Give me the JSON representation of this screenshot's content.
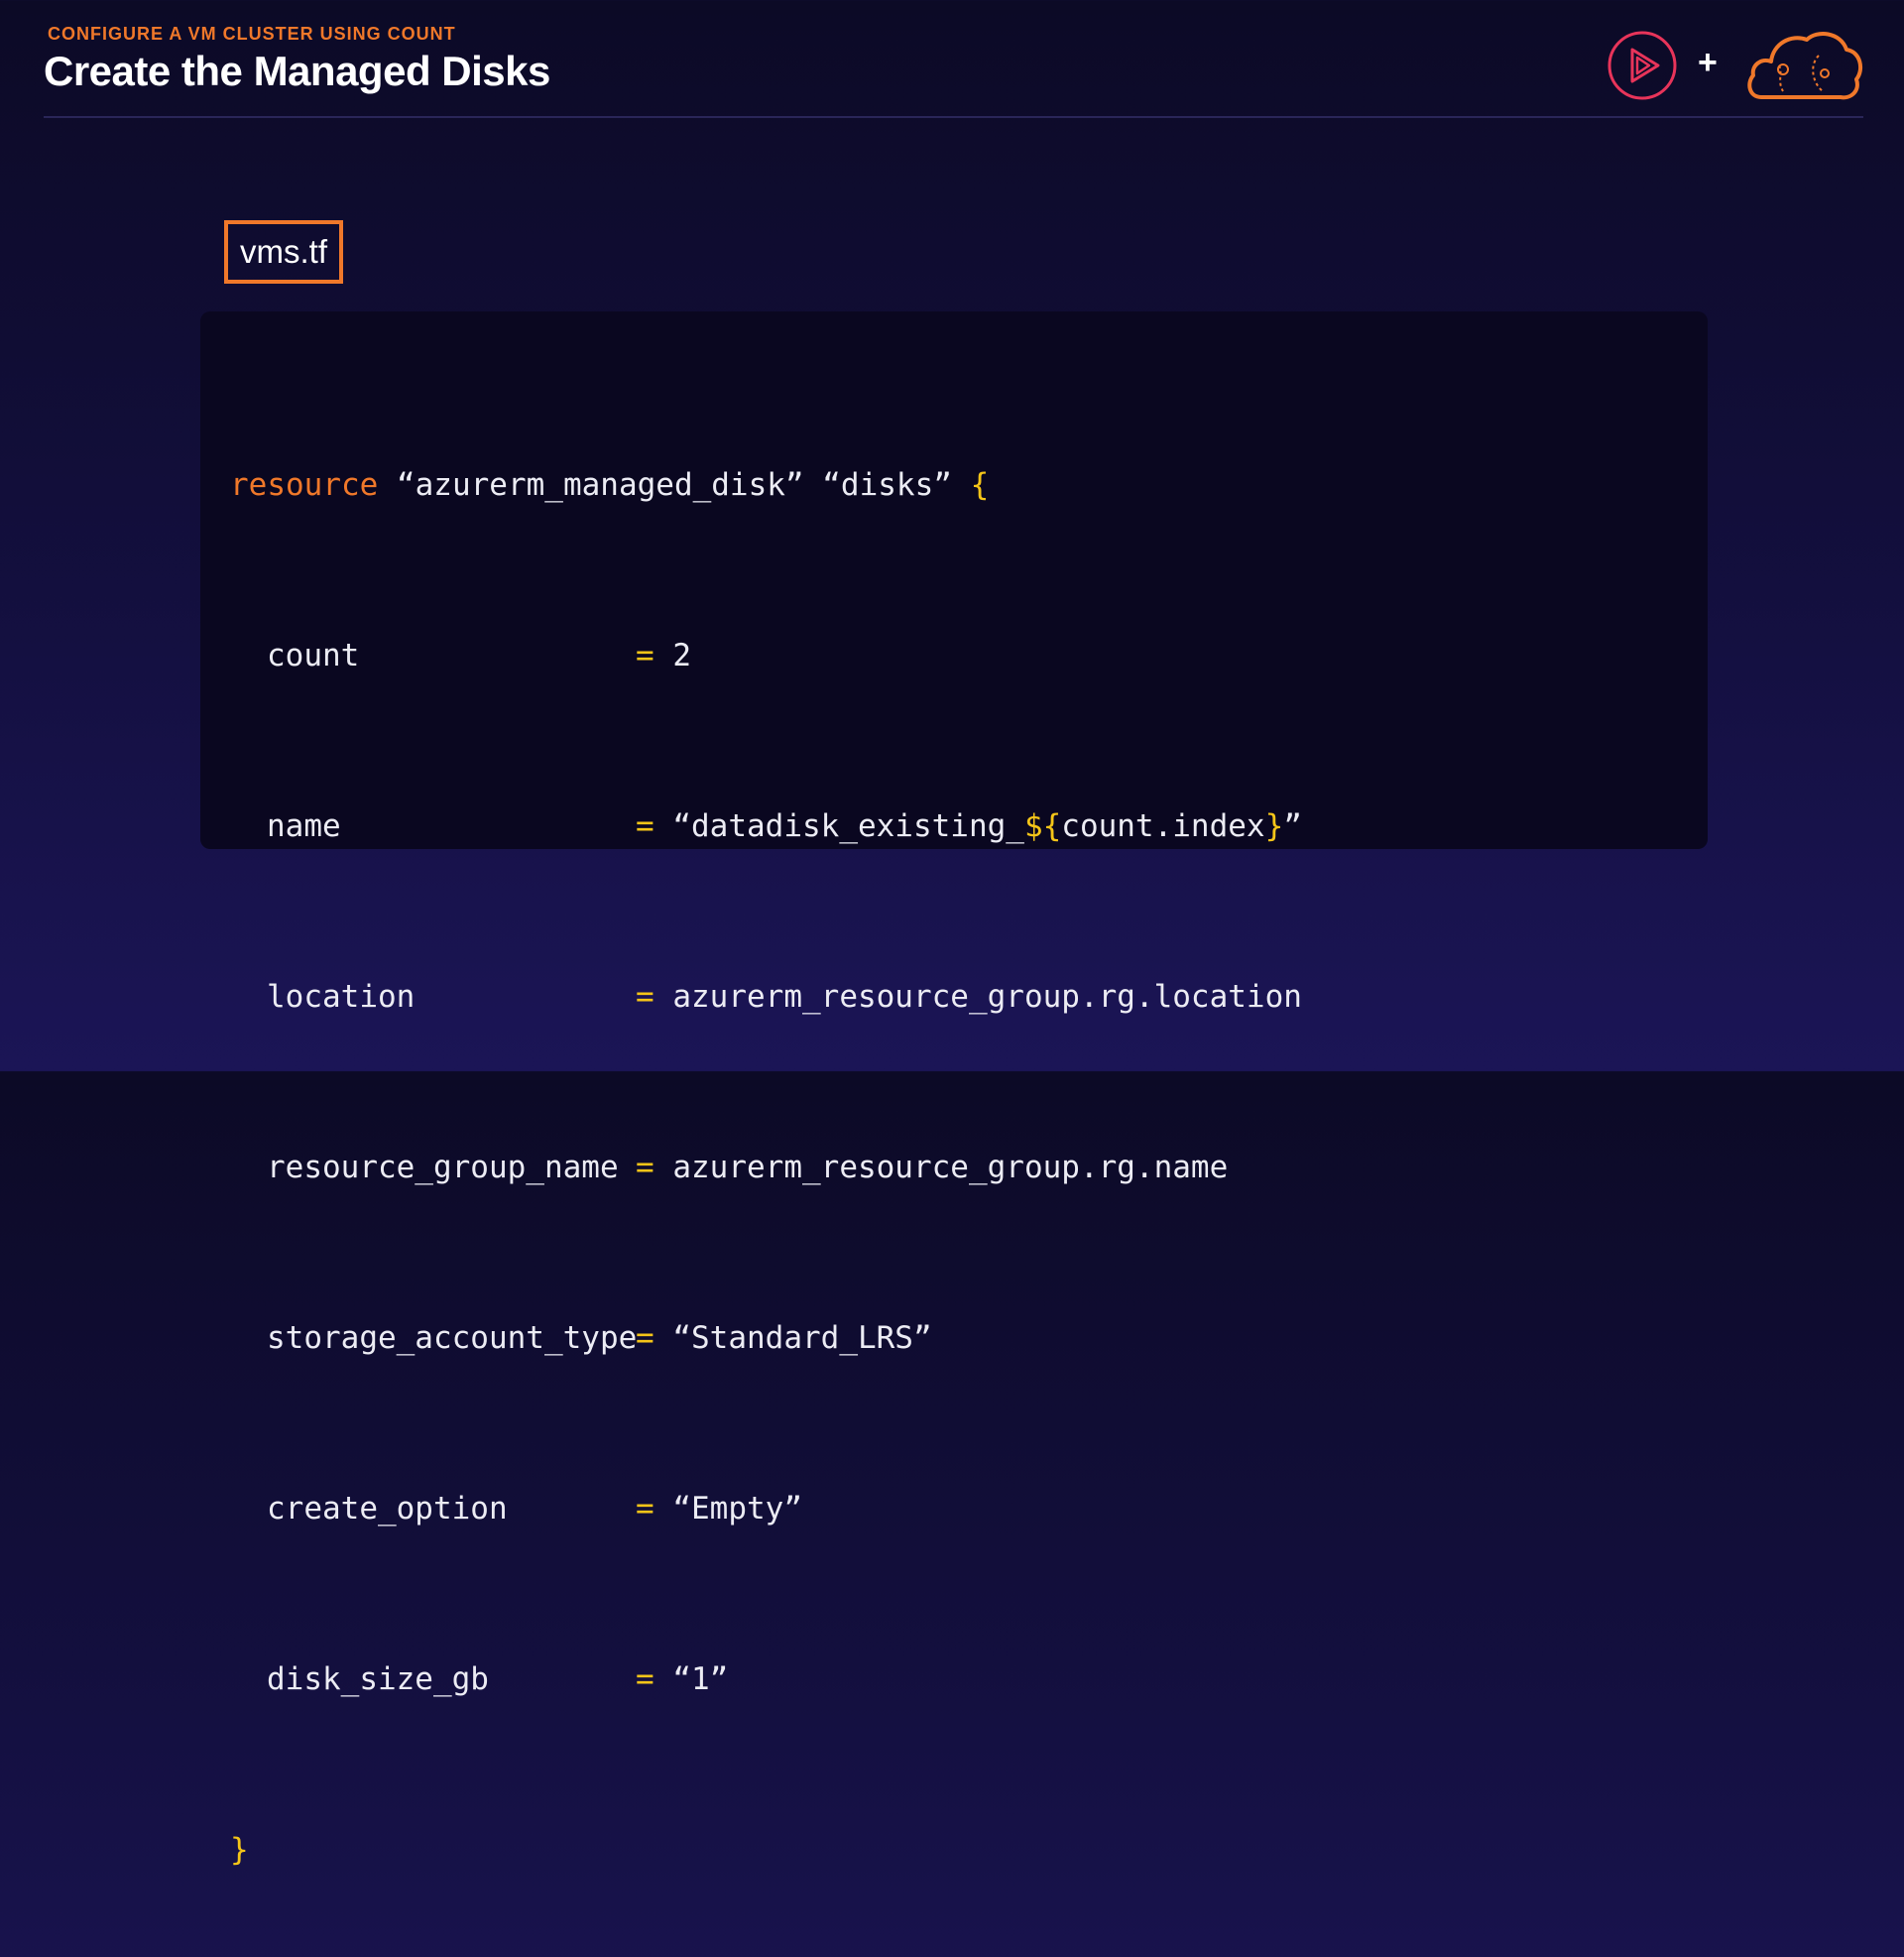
{
  "header": {
    "eyebrow": "CONFIGURE A VM CLUSTER USING COUNT",
    "title": "Create the Managed Disks"
  },
  "logos": {
    "play_icon": "play-circle-icon",
    "plus": "+",
    "cloud_icon": "cloud-icon"
  },
  "file_tab": {
    "label": "vms.tf"
  },
  "code": {
    "keyword": "resource",
    "resource_type": "“azurerm_managed_disk”",
    "resource_name": "“disks”",
    "open_brace": "{",
    "close_brace": "}",
    "equals": "=",
    "attributes": [
      {
        "key": "count",
        "value": "2"
      },
      {
        "key": "name",
        "value_prefix": "“datadisk_existing_",
        "value_interp_open": "${",
        "value_interp": "count.index",
        "value_interp_close": "}",
        "value_suffix": "”"
      },
      {
        "key": "location",
        "value": "azurerm_resource_group.rg.location"
      },
      {
        "key": "resource_group_name",
        "value": "azurerm_resource_group.rg.name"
      },
      {
        "key": "storage_account_type",
        "value": "“Standard_LRS”"
      },
      {
        "key": "create_option",
        "value": "“Empty”"
      },
      {
        "key": "disk_size_gb",
        "value": "“1”"
      }
    ]
  },
  "colors": {
    "accent_orange": "#f0782a",
    "accent_yellow": "#f5c518",
    "background": "#130f3e",
    "code_panel": "#0a0720"
  }
}
